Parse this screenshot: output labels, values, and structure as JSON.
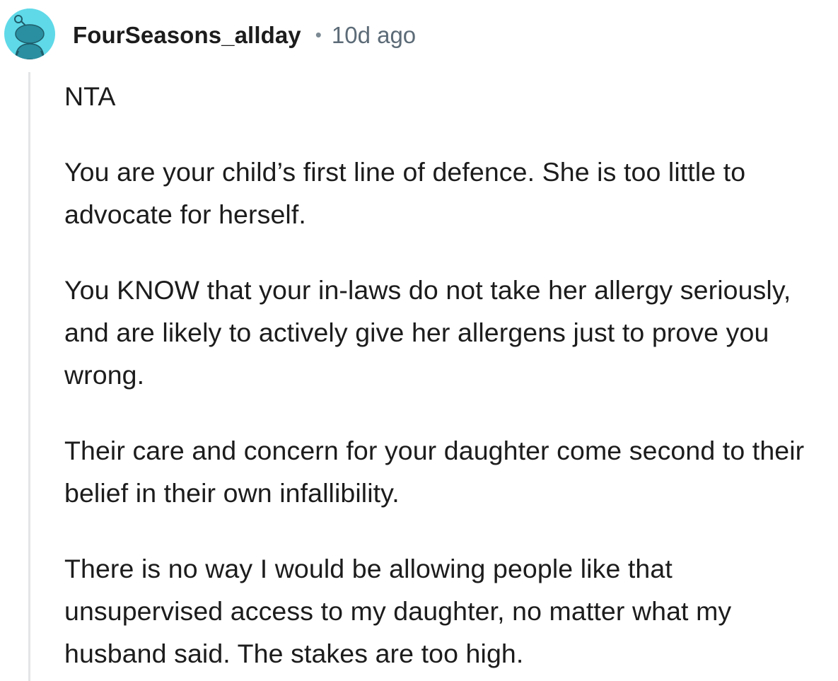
{
  "comment": {
    "username": "FourSeasons_allday",
    "separator": "•",
    "age": "10d ago",
    "paragraphs": [
      "NTA",
      "You are your child’s first line of defence. She is too little to advocate for herself.",
      "You KNOW that your in-laws do not take her allergy seriously, and are likely to actively give her allergens just to prove you wrong.",
      "Their care and concern for your daughter come second to their belief in their own infallibility.",
      "There is no way I would be allowing people like that unsupervised access to my daughter, no matter what my husband said. The stakes are too high."
    ]
  },
  "avatar": {
    "icon": "snoo-avatar-icon",
    "background": "#5fd9e8"
  },
  "colors": {
    "text": "#1c1c1c",
    "meta": "#5c6b77",
    "thread_line": "#e3e5e7"
  }
}
